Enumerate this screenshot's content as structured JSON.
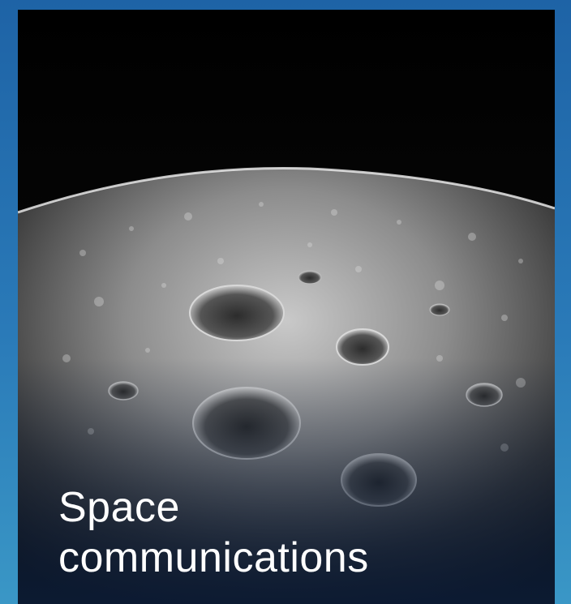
{
  "tile": {
    "title_line1": "Space",
    "title_line2": "communications",
    "image_icon": "moon-surface-icon"
  },
  "colors": {
    "background_top": "#1e63a6",
    "background_bottom": "#3a97c6",
    "caption_text": "#ffffff",
    "caption_band": "#0b1a33"
  }
}
